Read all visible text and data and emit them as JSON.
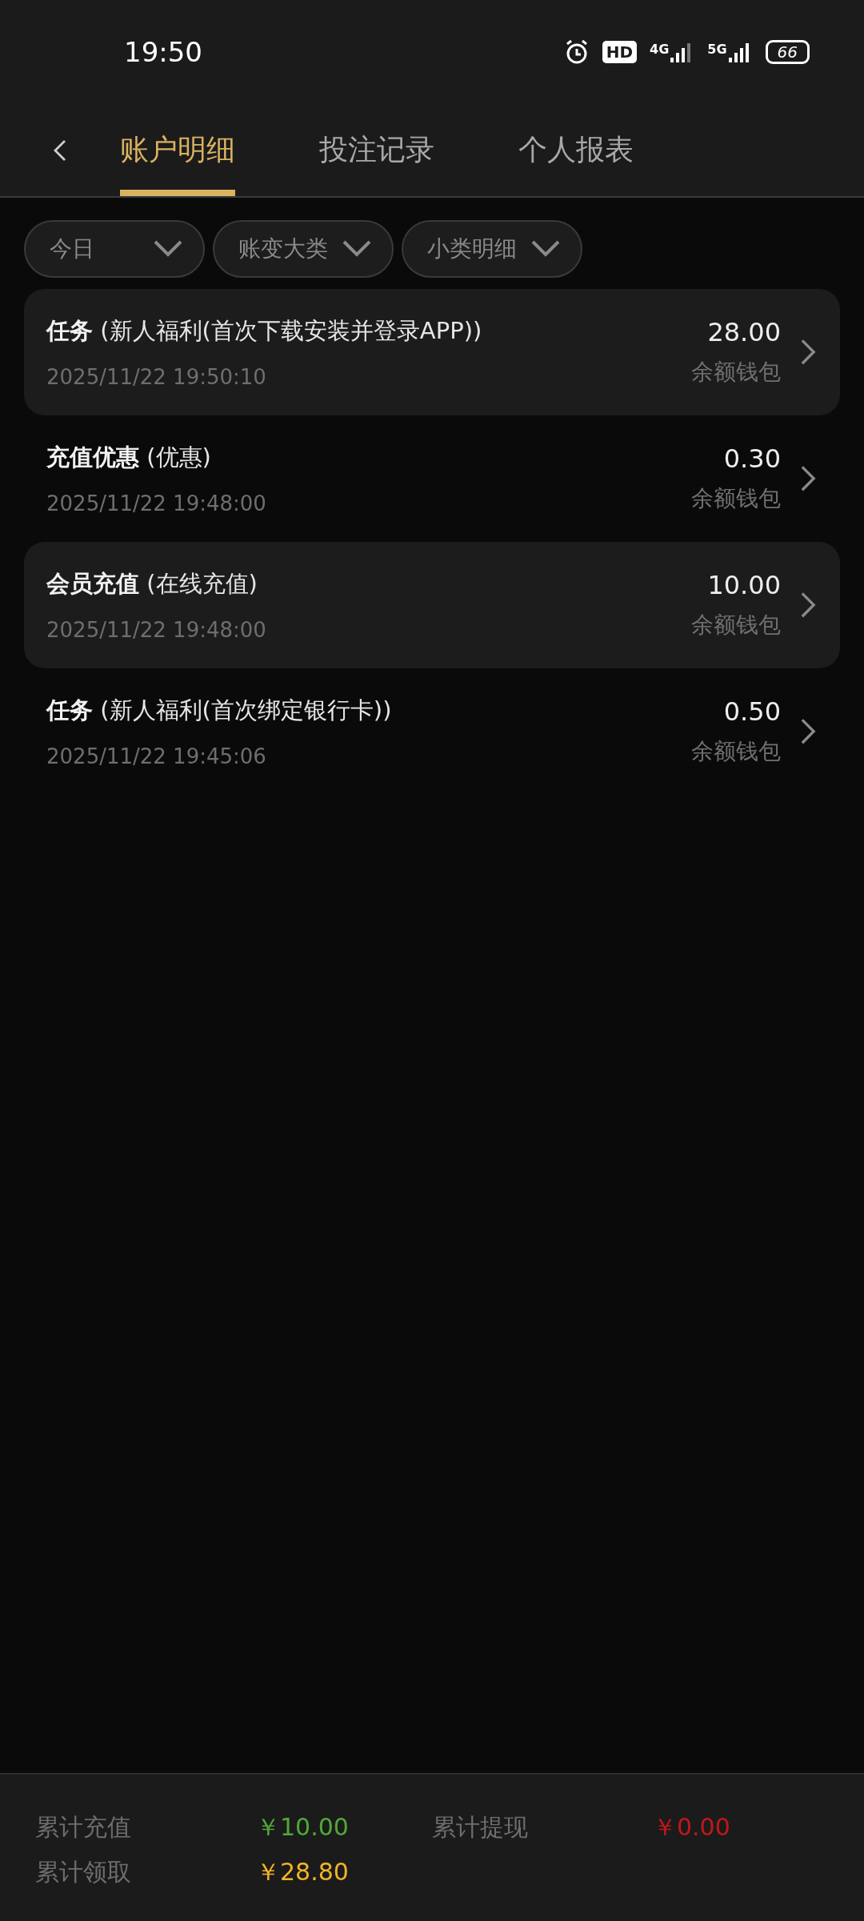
{
  "status_bar": {
    "time": "19:50",
    "hd_label": "HD",
    "networks": [
      "4G",
      "5G"
    ],
    "battery": "66"
  },
  "tabs": [
    {
      "label": "账户明细",
      "selected": true
    },
    {
      "label": "投注记录",
      "selected": false
    },
    {
      "label": "个人报表",
      "selected": false
    }
  ],
  "filters": [
    {
      "label": "今日"
    },
    {
      "label": "账变大类"
    },
    {
      "label": "小类明细"
    }
  ],
  "records": [
    {
      "title": "**任务** (新人福利(首次下载安装并登录APP))",
      "time": "2025/11/22 19:50:10",
      "amount": "28.00",
      "wallet": "余额钱包"
    },
    {
      "title": "**充值优惠** (优惠)",
      "time": "2025/11/22 19:48:00",
      "amount": "0.30",
      "wallet": "余额钱包"
    },
    {
      "title": "**会员充值** (在线充值)",
      "time": "2025/11/22 19:48:00",
      "amount": "10.00",
      "wallet": "余额钱包"
    },
    {
      "title": "**任务** (新人福利(首次绑定银行卡))",
      "time": "2025/11/22 19:45:06",
      "amount": "0.50",
      "wallet": "余额钱包"
    }
  ],
  "summary": [
    {
      "label": "累计充值",
      "value": "￥10.00",
      "color": "#52a838"
    },
    {
      "label": "累计提现",
      "value": "￥0.00",
      "color": "#c01818"
    },
    {
      "label": "累计领取",
      "value": "￥28.80",
      "color": "#f0b429"
    }
  ]
}
